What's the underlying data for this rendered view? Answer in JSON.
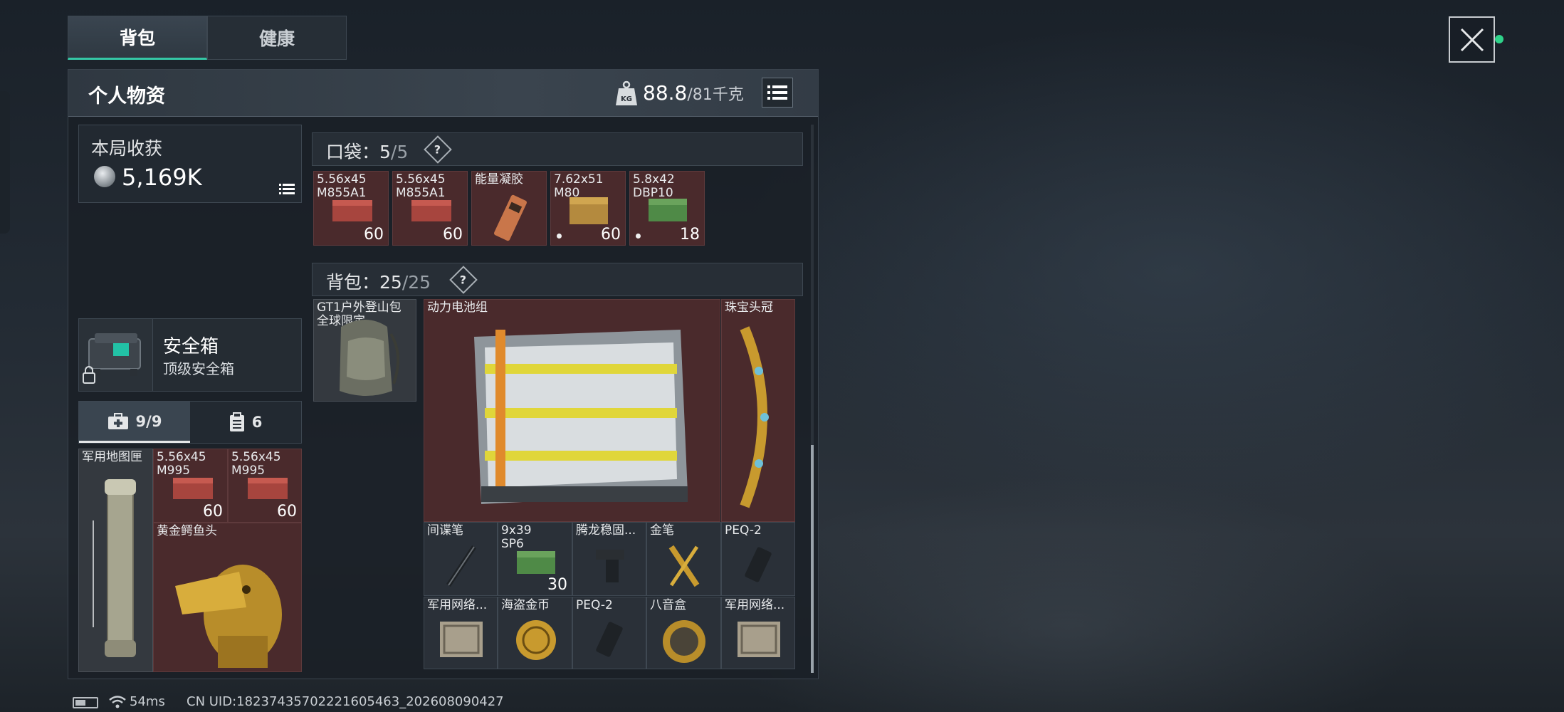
{
  "tabs": [
    {
      "label": "背包",
      "active": true
    },
    {
      "label": "健康",
      "active": false
    }
  ],
  "panel": {
    "title": "个人物资",
    "weight_current": "88.8",
    "weight_max": "/81千克"
  },
  "harvest": {
    "label": "本局收获",
    "value": "5,169K"
  },
  "safe_box": {
    "title": "安全箱",
    "subtitle": "顶级安全箱"
  },
  "sub_tabs": [
    {
      "label": "9/9",
      "icon": "medkit-icon",
      "active": true
    },
    {
      "label": "6",
      "icon": "clipboard-icon",
      "active": false
    }
  ],
  "left_items": [
    {
      "name": "军用地图匣",
      "count": ""
    },
    {
      "name": "5.56x45\nM995",
      "count": "60"
    },
    {
      "name": "5.56x45\nM995",
      "count": "60"
    },
    {
      "name": "黄金鳄鱼头",
      "count": ""
    }
  ],
  "pocket": {
    "label": "口袋：",
    "used": "5",
    "capacity": "/5",
    "help": "?",
    "items": [
      {
        "name": "5.56x45\nM855A1",
        "count": "60",
        "dot": false
      },
      {
        "name": "5.56x45\nM855A1",
        "count": "60",
        "dot": false
      },
      {
        "name": "能量凝胶",
        "count": "",
        "dot": false
      },
      {
        "name": "7.62x51\nM80",
        "count": "60",
        "dot": true
      },
      {
        "name": "5.8x42\nDBP10",
        "count": "18",
        "dot": true
      }
    ]
  },
  "backpack": {
    "label": "背包：",
    "used": "25",
    "capacity": "/25",
    "help": "?",
    "bag_name": "GT1户外登山包\n全球限定",
    "items": [
      {
        "name": "动力电池组",
        "count": ""
      },
      {
        "name": "珠宝头冠",
        "count": ""
      },
      {
        "name": "间谍笔",
        "count": ""
      },
      {
        "name": "9x39\nSP6",
        "count": "30"
      },
      {
        "name": "腾龙稳固...",
        "count": ""
      },
      {
        "name": "金笔",
        "count": ""
      },
      {
        "name": "PEQ-2",
        "count": ""
      },
      {
        "name": "军用网络...",
        "count": ""
      },
      {
        "name": "海盗金币",
        "count": ""
      },
      {
        "name": "PEQ-2",
        "count": ""
      },
      {
        "name": "八音盒",
        "count": ""
      },
      {
        "name": "军用网络...",
        "count": ""
      }
    ]
  },
  "status": {
    "ping": "54ms",
    "uid": "CN UID:18237435702221605463_202608090427"
  },
  "colors": {
    "accent": "#35c7a5",
    "rare_red": "#4a2a2c",
    "online_dot": "#2fd38a"
  }
}
